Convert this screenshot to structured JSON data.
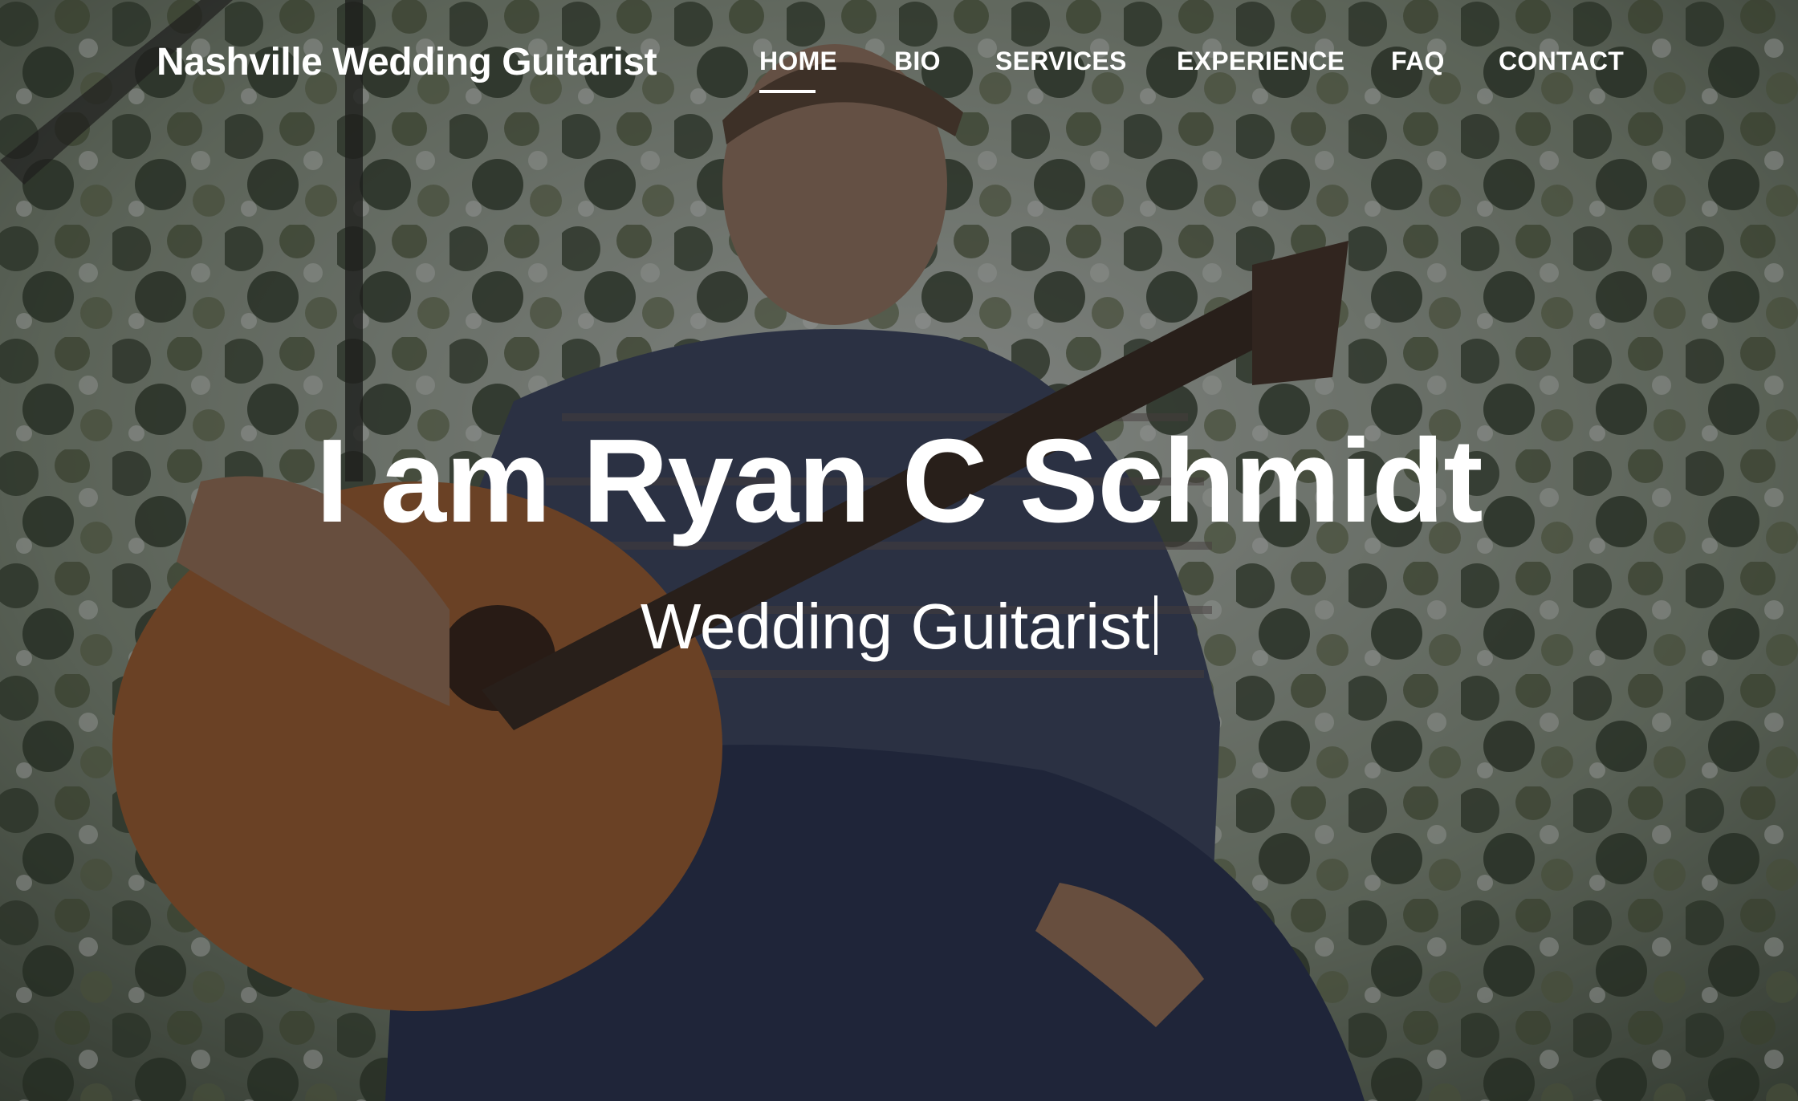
{
  "site": {
    "brand": "Nashville Wedding Guitarist"
  },
  "nav": {
    "items": [
      {
        "label": "HOME",
        "active": true
      },
      {
        "label": "BIO",
        "active": false
      },
      {
        "label": "SERVICES",
        "active": false
      },
      {
        "label": "EXPERIENCE",
        "active": false
      },
      {
        "label": "FAQ",
        "active": false
      },
      {
        "label": "CONTACT",
        "active": false
      }
    ]
  },
  "hero": {
    "title": "I am Ryan C Schmidt",
    "subtitle": "Wedding Guitarist",
    "background": "photo of guitarist sitting with a classical guitar among trees"
  },
  "colors": {
    "text": "#ffffff",
    "overlay": "#0a0c14"
  }
}
